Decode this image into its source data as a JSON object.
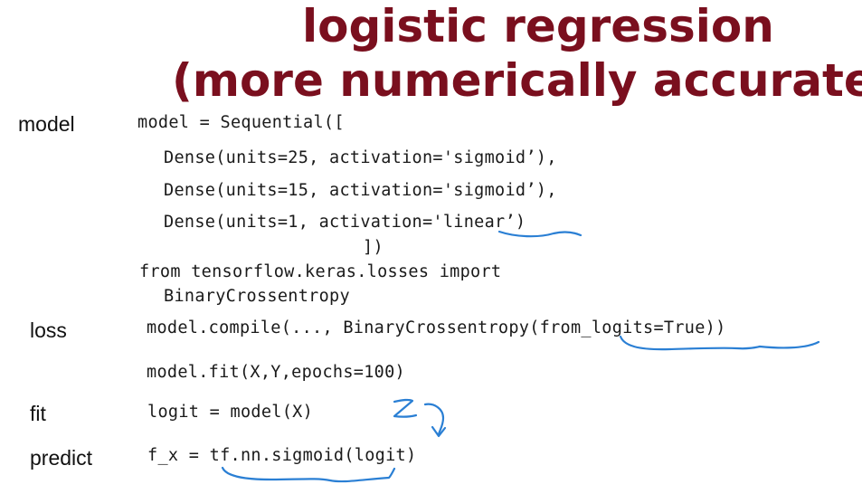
{
  "title": {
    "line1": "logistic regression",
    "line2": "(more numerically accurate)"
  },
  "labels": {
    "model": "model",
    "loss": "loss",
    "fit": "fit",
    "predict": "predict"
  },
  "code": {
    "model_line": "model = Sequential([",
    "dense1": "Dense(units=25, activation='sigmoid’),",
    "dense2": "Dense(units=15, activation='sigmoid’),",
    "dense3": "Dense(units=1, activation='linear’)",
    "close": "])",
    "import1": "from tensorflow.keras.losses import",
    "import2": "BinaryCrossentropy",
    "compile": "model.compile(..., BinaryCrossentropy(from_logits=True))",
    "fit": "model.fit(X,Y,epochs=100)",
    "logit": "logit = model(X)",
    "predict": "f_x = tf.nn.sigmoid(logit)"
  },
  "annotations": {
    "z_mark": "z"
  },
  "colors": {
    "title": "#7a0f1e",
    "ink": "#2a7fd4"
  }
}
